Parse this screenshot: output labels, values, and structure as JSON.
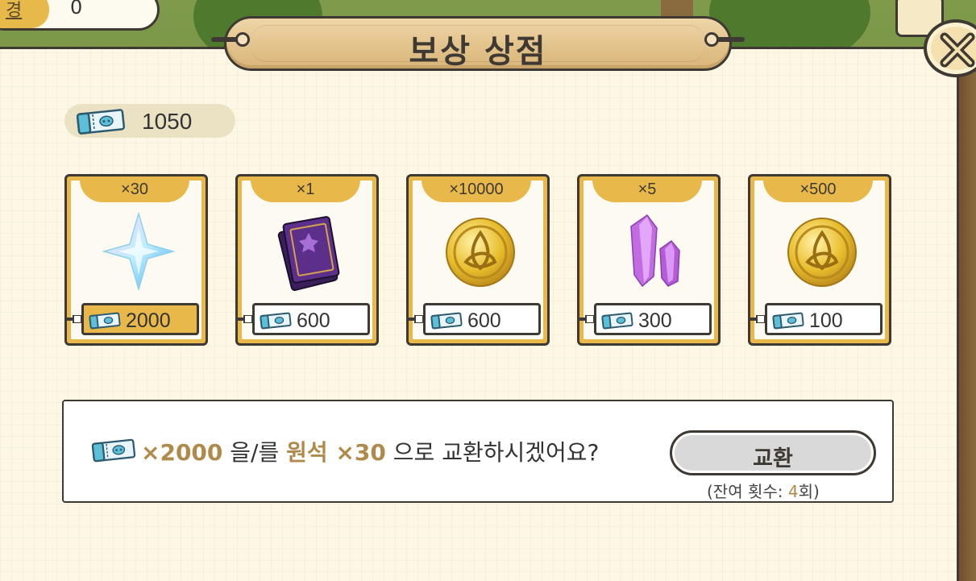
{
  "top_stat": {
    "label": "경",
    "value": "0"
  },
  "title": "보상 상점",
  "currency": {
    "icon": "ticket-icon",
    "amount": "1050"
  },
  "items": [
    {
      "quantity": "×30",
      "price": "2000",
      "icon": "primogem-star-icon",
      "selected": true
    },
    {
      "quantity": "×1",
      "price": "600",
      "icon": "purple-book-icon",
      "selected": false
    },
    {
      "quantity": "×10000",
      "price": "600",
      "icon": "gold-coin-icon",
      "selected": false
    },
    {
      "quantity": "×5",
      "price": "300",
      "icon": "purple-crystal-icon",
      "selected": false
    },
    {
      "quantity": "×500",
      "price": "100",
      "icon": "gold-coin-icon",
      "selected": false
    }
  ],
  "confirm": {
    "cost": "×2000",
    "particle1": "을/를",
    "reward": "원석 ×30",
    "particle2": "으로 교환하시겠어요?",
    "button_label": "교환",
    "remaining_prefix": "(잔여 횟수: ",
    "remaining_count": "4",
    "remaining_suffix": "회)"
  },
  "colors": {
    "accent_gold": "#e9b84a",
    "highlight_text": "#b08a4a",
    "outline": "#3e3a33"
  }
}
